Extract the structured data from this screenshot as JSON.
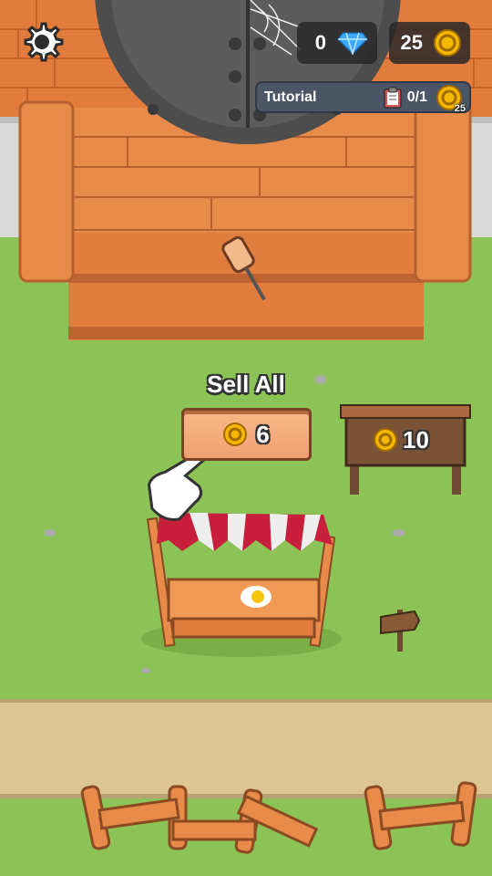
{
  "hud": {
    "gems": "0",
    "coins": "25",
    "settings_icon": "gear-icon",
    "gem_icon": "blue-diamond-icon",
    "coin_icon": "gold-coin-icon"
  },
  "tutorial": {
    "label": "Tutorial",
    "progress": "0/1",
    "reward": "25",
    "clipboard_icon": "clipboard-icon"
  },
  "sell": {
    "label": "Sell All",
    "amount": "6"
  },
  "price_sign": {
    "amount": "10"
  },
  "colors": {
    "grass": "#8cc356",
    "wood": "#e8874a",
    "path": "#dcc591",
    "awning_red": "#c8203c",
    "awning_white": "#eeeeee"
  }
}
